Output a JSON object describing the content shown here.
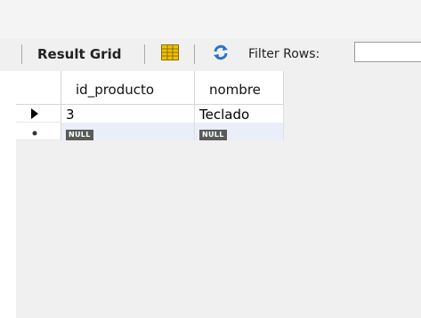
{
  "toolbar": {
    "result_grid_label": "Result Grid",
    "filter_rows_label": "Filter Rows:",
    "filter_value": ""
  },
  "icons": {
    "grid_toggle": "form-grid-icon",
    "refresh": "refresh-icon",
    "current_row": "row-pointer-icon",
    "new_row": "new-row-asterisk-icon"
  },
  "colors": {
    "null_badge_bg": "#5a5a5a",
    "new_row_bg": "#e9eef9",
    "grid_icon_yellow": "#f2c200",
    "refresh_blue": "#2a73c9"
  },
  "grid": {
    "columns": [
      "id_producto",
      "nombre"
    ],
    "rows": [
      [
        "3",
        "Teclado"
      ]
    ],
    "new_row": [
      "NULL",
      "NULL"
    ]
  }
}
